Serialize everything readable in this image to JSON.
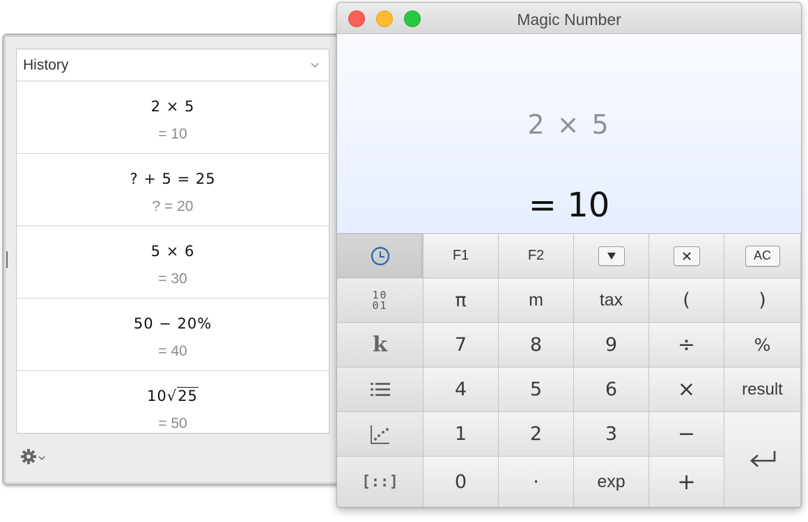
{
  "history": {
    "title": "History",
    "entries": [
      {
        "expression": "2 × 5",
        "result": "= 10"
      },
      {
        "expression": "? + 5 = 25",
        "result": "? = 20"
      },
      {
        "expression": "5 × 6",
        "result": "= 30"
      },
      {
        "expression": "50 − 20%",
        "result": "= 40"
      },
      {
        "expression_prefix": "10",
        "expression_radicand": "25",
        "result": "= 50"
      }
    ]
  },
  "window": {
    "title": "Magic Number"
  },
  "display": {
    "expression": "2 × 5",
    "result": "= 10"
  },
  "keys": {
    "f1": "F1",
    "f2": "F2",
    "ac": "AC",
    "pi": "π",
    "m": "m",
    "tax": "tax",
    "lparen": "(",
    "rparen": ")",
    "n7": "7",
    "n8": "8",
    "n9": "9",
    "divide": "÷",
    "percent": "%",
    "n4": "4",
    "n5": "5",
    "n6": "6",
    "multiply": "×",
    "result": "result",
    "n1": "1",
    "n2": "2",
    "n3": "3",
    "minus": "−",
    "n0": "0",
    "dot": "·",
    "exp": "exp",
    "plus": "+",
    "binary_top": "10",
    "binary_bottom": "01",
    "constant_k": "k",
    "matrix": "[::]"
  },
  "colors": {
    "close": "#fc5f57",
    "minimize": "#fdbc2e",
    "maximize": "#28c840",
    "history_icon": "#2a6fb0"
  }
}
